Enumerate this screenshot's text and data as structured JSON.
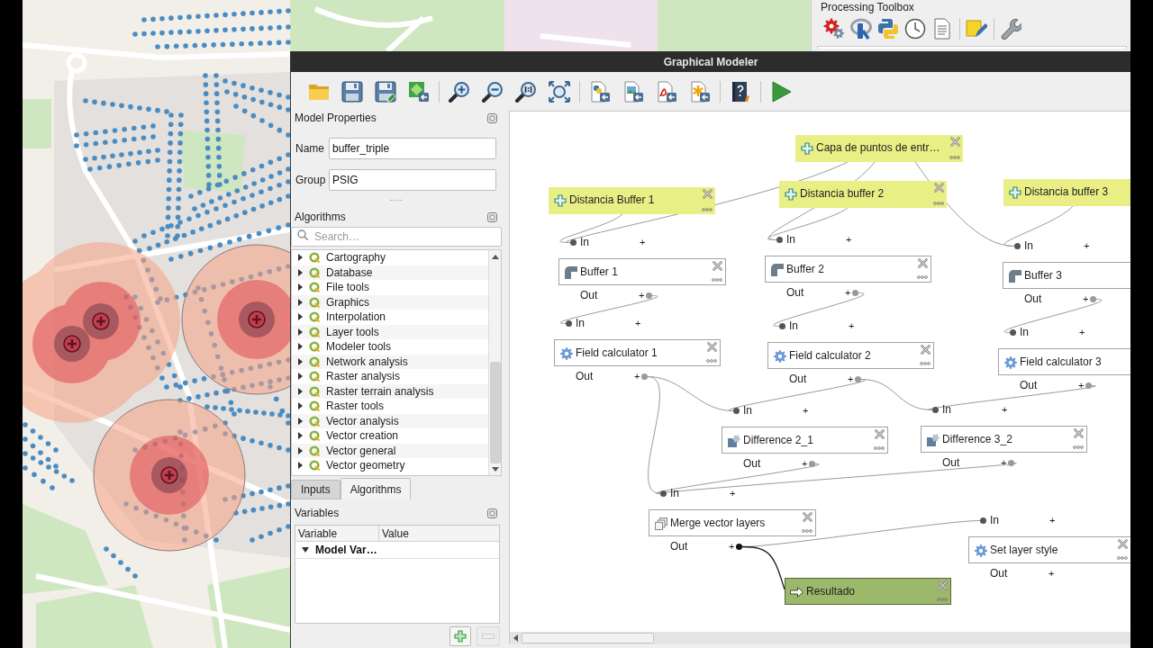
{
  "window": {
    "title": "Graphical Modeler"
  },
  "processing_toolbox": {
    "title": "Processing Toolbox"
  },
  "model_properties": {
    "title": "Model Properties",
    "fields": [
      {
        "label": "Name",
        "value": "buffer_triple"
      },
      {
        "label": "Group",
        "value": "PSIG"
      }
    ]
  },
  "algorithms": {
    "title": "Algorithms",
    "search": {
      "placeholder": "Search…"
    },
    "groups": [
      {
        "label": "Cartography",
        "expanded": false
      },
      {
        "label": "Database",
        "expanded": false
      },
      {
        "label": "File tools",
        "expanded": false
      },
      {
        "label": "Graphics",
        "expanded": false
      },
      {
        "label": "Interpolation",
        "expanded": false
      },
      {
        "label": "Layer tools",
        "expanded": false
      },
      {
        "label": "Modeler tools",
        "expanded": false
      },
      {
        "label": "Network analysis",
        "expanded": false
      },
      {
        "label": "Raster analysis",
        "expanded": false
      },
      {
        "label": "Raster terrain analysis",
        "expanded": false
      },
      {
        "label": "Raster tools",
        "expanded": false
      },
      {
        "label": "Vector analysis",
        "expanded": false
      },
      {
        "label": "Vector creation",
        "expanded": false
      },
      {
        "label": "Vector general",
        "expanded": false
      },
      {
        "label": "Vector geometry",
        "expanded": false
      }
    ]
  },
  "tabs": [
    {
      "label": "Inputs",
      "selected": false
    },
    {
      "label": "Algorithms",
      "selected": true
    }
  ],
  "variables": {
    "title": "Variables",
    "columns": [
      "Variable",
      "Value"
    ],
    "rows": [
      {
        "label": "Model Var…",
        "expanded": true
      }
    ],
    "buttons": [
      {
        "kind": "add",
        "disabled": false
      },
      {
        "kind": "remove",
        "disabled": true
      }
    ]
  },
  "canvas": {
    "nodes": [
      {
        "kind": "input",
        "label": "Capa de puntos de entr…"
      },
      {
        "kind": "input",
        "label": "Distancia Buffer 1"
      },
      {
        "kind": "input",
        "label": "Distancia buffer 2"
      },
      {
        "kind": "input",
        "label": "Distancia buffer 3"
      },
      {
        "kind": "algorithm",
        "label": "Buffer 1",
        "input": {
          "label": "In",
          "toggle": "+"
        },
        "output": {
          "label": "Out",
          "toggle": "+"
        }
      },
      {
        "kind": "algorithm",
        "label": "Buffer 2",
        "input": {
          "label": "In",
          "toggle": "+"
        },
        "output": {
          "label": "Out",
          "toggle": "+"
        }
      },
      {
        "kind": "algorithm",
        "label": "Buffer 3",
        "input": {
          "label": "In",
          "toggle": "+"
        },
        "output": {
          "label": "Out",
          "toggle": "+"
        }
      },
      {
        "kind": "algorithm",
        "label": "Field calculator 1",
        "input": {
          "label": "In",
          "toggle": "+"
        },
        "output": {
          "label": "Out",
          "toggle": "+"
        }
      },
      {
        "kind": "algorithm",
        "label": "Field calculator 2",
        "input": {
          "label": "In",
          "toggle": "+"
        },
        "output": {
          "label": "Out",
          "toggle": "+"
        }
      },
      {
        "kind": "algorithm",
        "label": "Field calculator 3",
        "input": {
          "label": "In",
          "toggle": "+"
        },
        "output": {
          "label": "Out",
          "toggle": "+"
        }
      },
      {
        "kind": "algorithm",
        "label": "Difference 2_1",
        "input": {
          "label": "In",
          "toggle": "+"
        },
        "output": {
          "label": "Out",
          "toggle": "+"
        }
      },
      {
        "kind": "algorithm",
        "label": "Difference 3_2",
        "input": {
          "label": "In",
          "toggle": "+"
        },
        "output": {
          "label": "Out",
          "toggle": "+"
        }
      },
      {
        "kind": "algorithm",
        "label": "Merge vector layers",
        "input": {
          "label": "In",
          "toggle": "+"
        },
        "output": {
          "label": "Out",
          "toggle": "+"
        }
      },
      {
        "kind": "algorithm",
        "label": "Set layer style",
        "input": {
          "label": "In",
          "toggle": "+"
        },
        "output": {
          "label": "Out",
          "toggle": "+"
        }
      },
      {
        "kind": "output",
        "label": "Resultado"
      }
    ]
  }
}
